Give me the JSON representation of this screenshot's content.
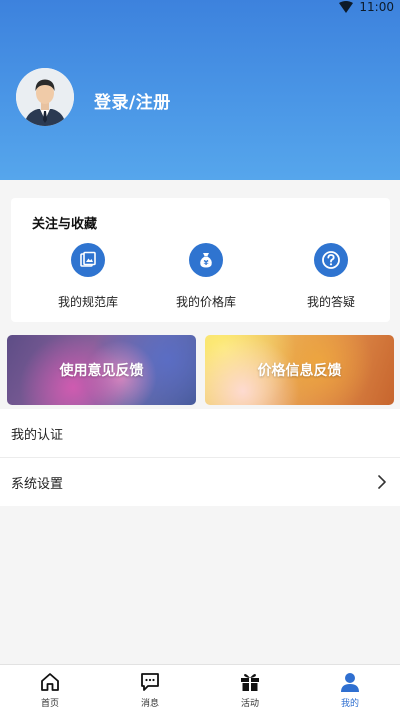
{
  "status_bar": {
    "time": "11:00"
  },
  "profile": {
    "login_label": "登录/注册"
  },
  "favorites": {
    "title": "关注与收藏",
    "items": [
      {
        "label": "我的规范库",
        "icon": "document-library-icon"
      },
      {
        "label": "我的价格库",
        "icon": "money-bag-icon"
      },
      {
        "label": "我的答疑",
        "icon": "question-icon"
      }
    ]
  },
  "banners": [
    {
      "label": "使用意见反馈"
    },
    {
      "label": "价格信息反馈"
    }
  ],
  "menu": [
    {
      "label": "我的认证"
    },
    {
      "label": "系统设置"
    }
  ],
  "bottom_nav": [
    {
      "label": "首页",
      "icon": "home-icon"
    },
    {
      "label": "消息",
      "icon": "message-icon"
    },
    {
      "label": "活动",
      "icon": "gift-icon"
    },
    {
      "label": "我的",
      "icon": "user-icon",
      "active": true
    }
  ],
  "colors": {
    "accent": "#2f74d0",
    "header_top": "#3d82dd",
    "header_bottom": "#56a6ec"
  }
}
